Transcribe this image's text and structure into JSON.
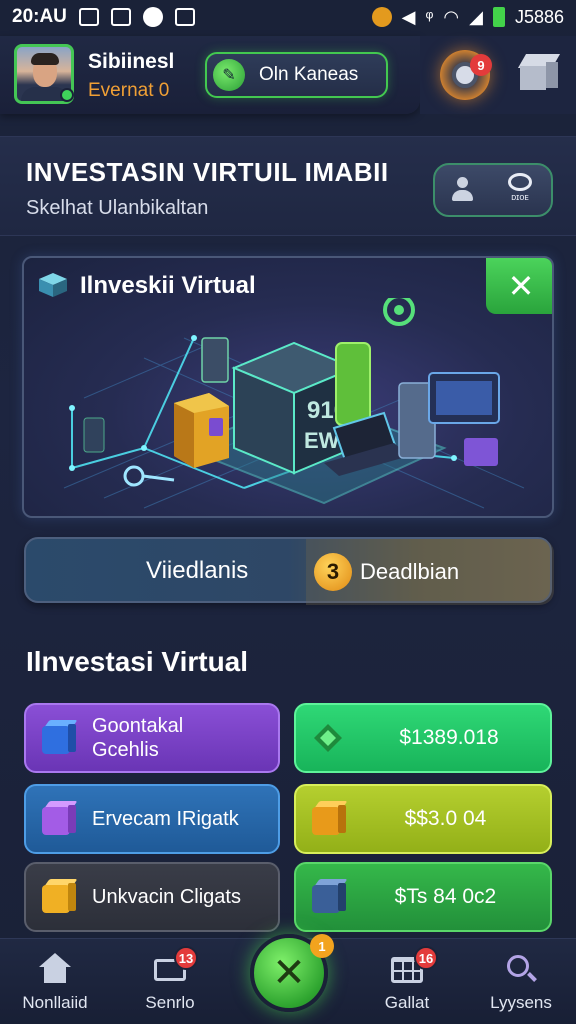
{
  "status_bar": {
    "time": "20:AU",
    "right_code": "Ј5886"
  },
  "header": {
    "user_name": "Sibiinesl",
    "user_subtitle": "Evernat 0",
    "status_pill": "Oln Kaneas",
    "notification_count": "9"
  },
  "title_section": {
    "title": "INVESTASIN VIRTUIL IMABII",
    "subtitle": "Skelhat Ulanbikaltan",
    "action_ring_caption": "ᴅɪᴏᴇ"
  },
  "hero": {
    "title": "Ilnveskii Virtual",
    "close_label": "✕",
    "screen_text_1": "910",
    "screen_text_2": "EWN"
  },
  "banner": {
    "left_label": "Viiedlanis",
    "badge": "3",
    "right_label": "Deadlbian"
  },
  "section": {
    "title": "Ilnvestasi Virtual"
  },
  "investments": {
    "left": [
      {
        "label_line1": "Goontakal",
        "label_line2": "Gcehlis"
      },
      {
        "label_line1": "Ervecam IRigatk",
        "label_line2": ""
      },
      {
        "label_line1": "Unkvacin Cligats",
        "label_line2": ""
      }
    ],
    "right": [
      {
        "value": "$1389.018"
      },
      {
        "value": "$$3.0 04"
      },
      {
        "value": "$Ts 84 0c2"
      }
    ]
  },
  "bottom_nav": {
    "items": [
      {
        "label": "Nonllaiid",
        "badge": ""
      },
      {
        "label": "Senrlo",
        "badge": "13"
      },
      {
        "label": "Gallat",
        "badge": "16"
      },
      {
        "label": "Lyysens",
        "badge": ""
      }
    ],
    "fab_label": "✕",
    "fab_badge": "1"
  },
  "colors": {
    "accent_green": "#43c850",
    "notification_red": "#e33b3b",
    "accent_orange": "#f0a035"
  }
}
